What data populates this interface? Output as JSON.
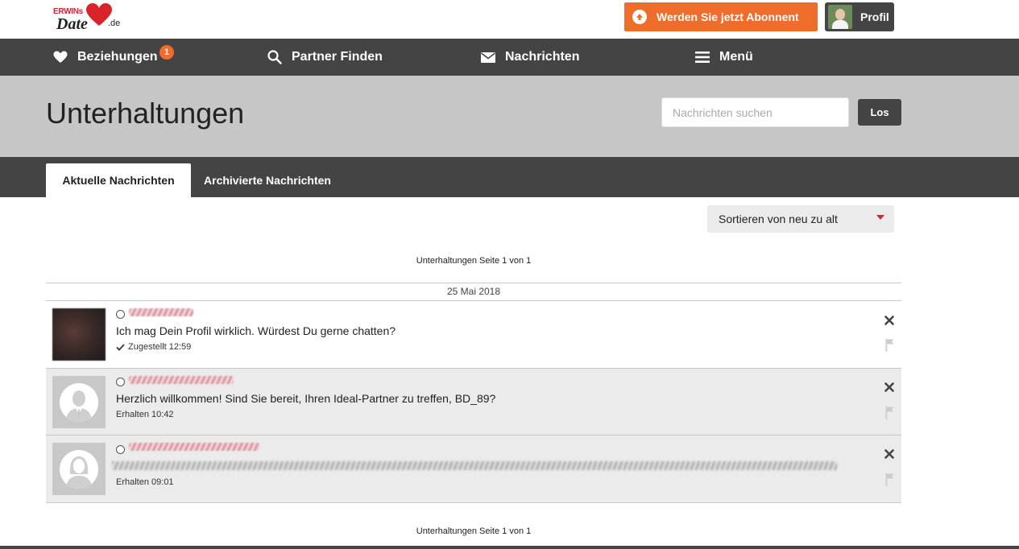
{
  "logo": {
    "brand_top": "ERWINs",
    "brand_script": "Date",
    "tld": ".de"
  },
  "topbar": {
    "subscribe_label": "Werden Sie jetzt Abonnent",
    "profile_label": "Profil"
  },
  "nav": {
    "items": [
      {
        "label": "Beziehungen",
        "icon": "heart-icon",
        "badge": "1"
      },
      {
        "label": "Partner Finden",
        "icon": "search-icon"
      },
      {
        "label": "Nachrichten",
        "icon": "envelope-icon"
      },
      {
        "label": "Menü",
        "icon": "hamburger-menu-icon"
      }
    ]
  },
  "header": {
    "title": "Unterhaltungen",
    "search_placeholder": "Nachrichten suchen",
    "search_button": "Los"
  },
  "tabs": [
    {
      "label": "Aktuelle Nachrichten",
      "active": true
    },
    {
      "label": "Archivierte Nachrichten",
      "active": false
    }
  ],
  "sort": {
    "selected": "Sortieren von neu zu alt"
  },
  "pager_top": "Unterhaltungen Seite 1 von 1",
  "date_separator": "25 Mai 2018",
  "conversations": [
    {
      "avatar": "photo",
      "message": "Ich mag Dein Profil wirklich. Würdest Du gerne chatten?",
      "status": "Zugestellt 12:59",
      "read": false
    },
    {
      "avatar": "male-placeholder",
      "message": "Herzlich willkommen! Sind Sie bereit, Ihren Ideal-Partner zu treffen, BD_89?",
      "status": "Erhalten 10:42",
      "read": true
    },
    {
      "avatar": "female-placeholder",
      "message": "",
      "status": "Erhalten 09:01",
      "read": true
    }
  ],
  "pager_bottom": "Unterhaltungen Seite 1 von 1",
  "colors": {
    "accent_orange": "#ee6d2b",
    "nav_dark": "#444444",
    "header_gray": "#c6c6c6",
    "brand_red": "#d8232a"
  }
}
